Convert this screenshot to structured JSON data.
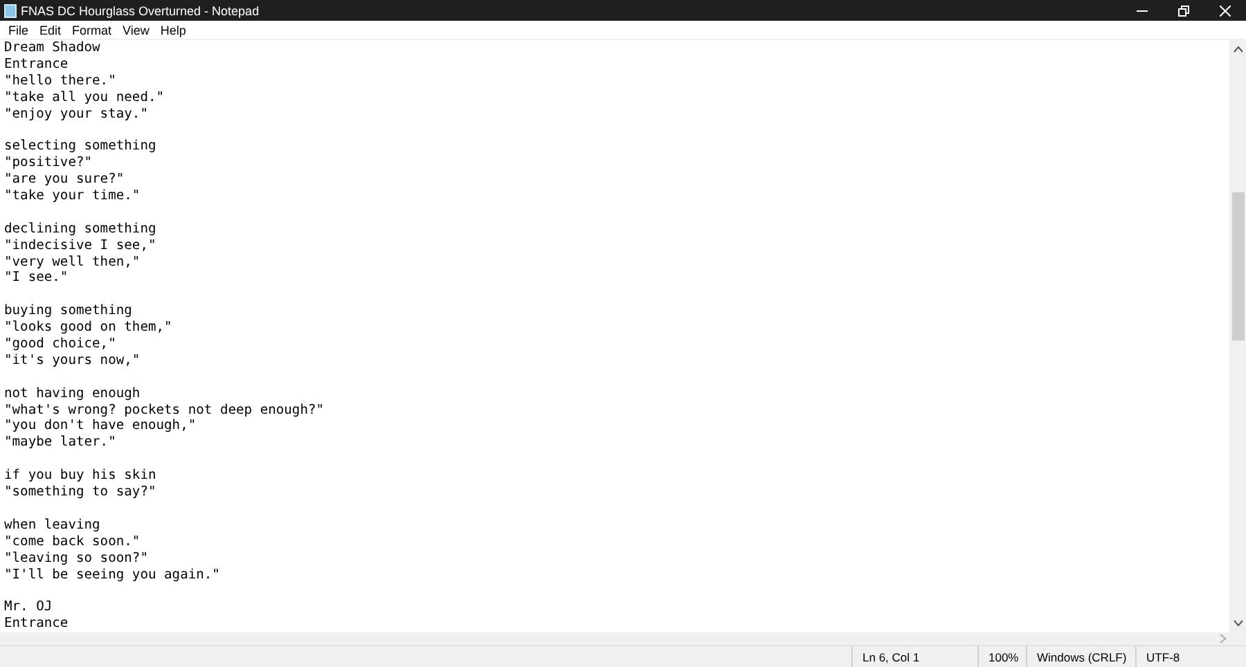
{
  "window": {
    "title": "FNAS DC Hourglass Overturned - Notepad"
  },
  "menu": [
    {
      "label": "File"
    },
    {
      "label": "Edit"
    },
    {
      "label": "Format"
    },
    {
      "label": "View"
    },
    {
      "label": "Help"
    }
  ],
  "paragraphs": [
    [
      "Dream Shadow",
      "Entrance",
      "\"hello there.\"",
      "\"take all you need.\"",
      "\"enjoy your stay.\""
    ],
    [
      "selecting something",
      "\"positive?\"",
      "\"are you sure?\"",
      "\"take your time.\""
    ],
    [
      "declining something",
      "\"indecisive I see,\"",
      "\"very well then,\"",
      "\"I see.\""
    ],
    [
      "buying something",
      "\"looks good on them,\"",
      "\"good choice,\"",
      "\"it's yours now,\""
    ],
    [
      "not having enough",
      "\"what's wrong? pockets not deep enough?\"",
      "\"you don't have enough,\"",
      "\"maybe later.\""
    ],
    [
      "if you buy his skin",
      "\"something to say?\""
    ],
    [
      "when leaving",
      "\"come back soon.\"",
      "\"leaving so soon?\"",
      "\"I'll be seeing you again.\""
    ],
    [
      "Mr. OJ",
      "Entrance"
    ]
  ],
  "status_bar": {
    "position": "Ln 6, Col 1",
    "zoom": "100%",
    "line_ending": "Windows (CRLF)",
    "encoding": "UTF-8"
  }
}
